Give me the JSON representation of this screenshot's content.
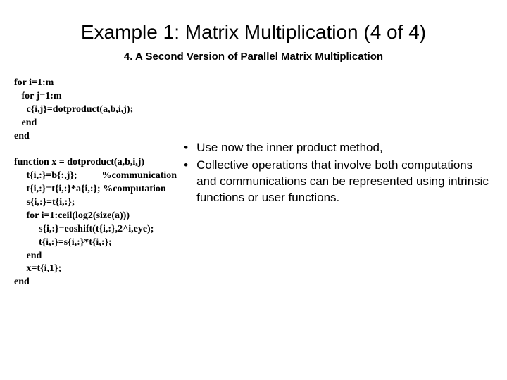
{
  "title": "Example 1: Matrix Multiplication (4 of 4)",
  "subtitle": "4. A Second Version of Parallel Matrix Multiplication",
  "code": {
    "l1": "for i=1:m",
    "l2": "   for j=1:m",
    "l3": "     c{i,j}=dotproduct(a,b,i,j);",
    "l4": "   end",
    "l5": "end",
    "l6": "",
    "l7": "function x = dotproduct(a,b,i,j)",
    "l8": "     t{i,:}=b{:,j};          %communication",
    "l9": "     t{i,:}=t{i,:}*a{i,:}; %computation",
    "l10": "     s{i,:}=t{i,:};",
    "l11": "     for i=1:ceil(log2(size(a)))",
    "l12": "          s{i,:}=eoshift(t{i,:},2^i,eye);",
    "l13": "          t{i,:}=s{i,:}*t{i,:};",
    "l14": "     end",
    "l15": "     x=t{i,1};",
    "l16": "end"
  },
  "bullets": [
    "Use now the inner product method,",
    "Collective operations that involve both computations and communications can be represented using intrinsic functions or user functions."
  ]
}
